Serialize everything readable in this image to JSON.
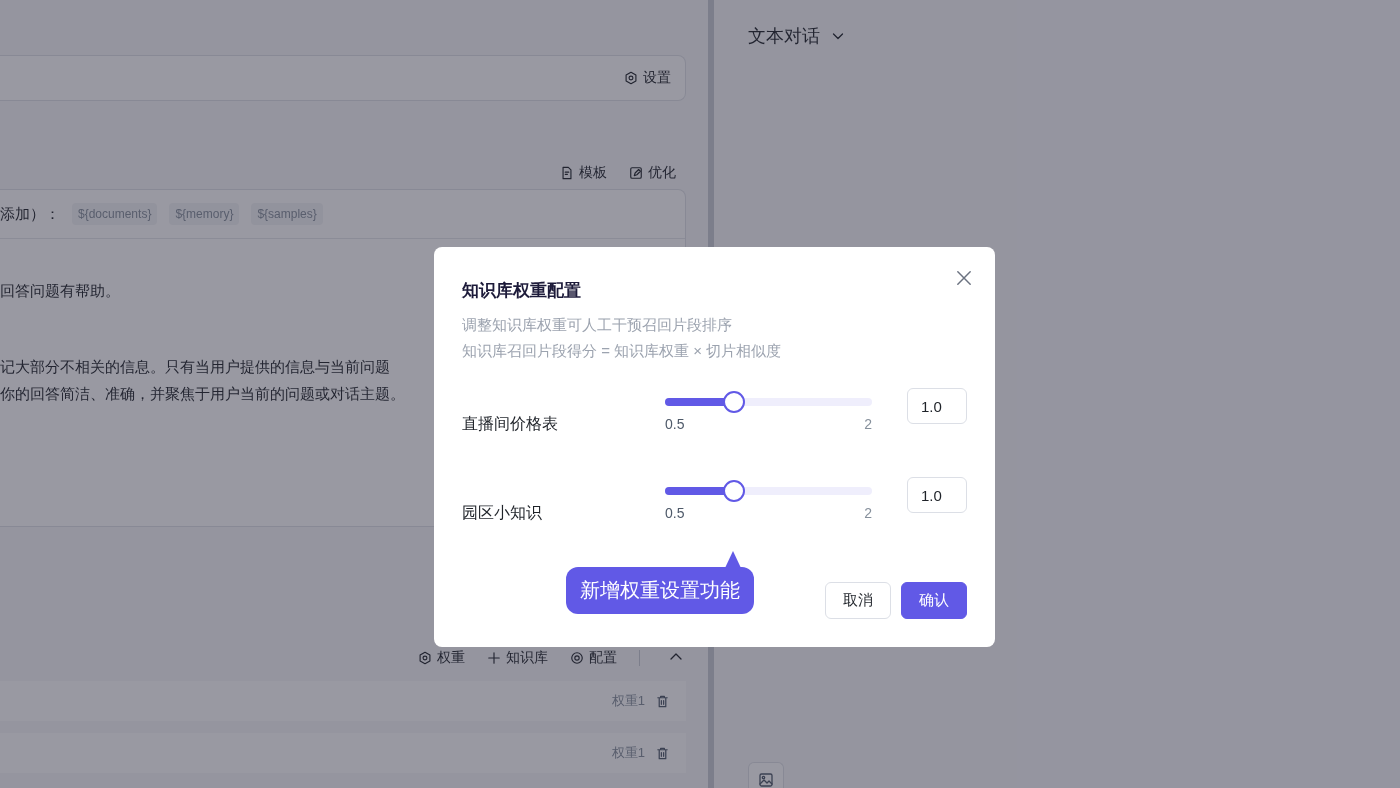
{
  "left_panel": {
    "settings_bar": {
      "button": "设置"
    },
    "prompt_toolbar": [
      {
        "label": "模板",
        "kind": "template"
      },
      {
        "label": "优化",
        "kind": "optimize"
      }
    ],
    "prompt": {
      "variables_label": "添加）：",
      "variables": [
        "${documents}",
        "${memory}",
        "${samples}"
      ],
      "lines": [
        "回答问题有帮助。",
        "记大部分不相关的信息。只有当用户提供的信息与当前问题",
        "你的回答简洁、准确，并聚焦于用户当前的问题或对话主题。"
      ]
    },
    "knowledge_toolbar": [
      {
        "label": "权重",
        "kind": "weight"
      },
      {
        "label": "知识库",
        "kind": "add"
      },
      {
        "label": "配置",
        "kind": "config"
      }
    ],
    "knowledge_rows": [
      {
        "weight": "权重1"
      },
      {
        "weight": "权重1"
      }
    ]
  },
  "right_panel": {
    "mode_select": "文本对话"
  },
  "dialog": {
    "title": "知识库权重配置",
    "description": [
      "调整知识库权重可人工干预召回片段排序",
      "知识库召回片段得分 = 知识库权重 × 切片相似度"
    ],
    "items": [
      {
        "name": "直播间价格表",
        "level": 0.333,
        "min": "0.5",
        "max": "2",
        "value": "1.0"
      },
      {
        "name": "园区小知识",
        "level": 0.333,
        "min": "0.5",
        "max": "2",
        "value": "1.0"
      }
    ],
    "tooltip": "新增权重设置功能",
    "buttons": [
      {
        "label": "取消",
        "kind": "secondary"
      },
      {
        "label": "确认",
        "kind": "primary"
      }
    ]
  }
}
